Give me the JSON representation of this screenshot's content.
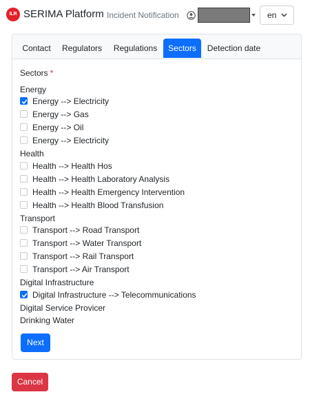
{
  "header": {
    "logo_text": "ILR",
    "brand": "SERIMA Platform",
    "nav_link": "Incident Notification",
    "language": "en"
  },
  "tabs": [
    {
      "label": "Contact"
    },
    {
      "label": "Regulators"
    },
    {
      "label": "Regulations"
    },
    {
      "label": "Sectors",
      "active": true
    },
    {
      "label": "Detection date"
    }
  ],
  "form": {
    "sectors_label": "Sectors",
    "required_marker": "*",
    "groups": [
      {
        "title": "Energy",
        "options": [
          {
            "label": "Energy --> Electricity",
            "checked": true
          },
          {
            "label": "Energy --> Gas",
            "checked": false
          },
          {
            "label": "Energy --> Oil",
            "checked": false
          },
          {
            "label": "Energy --> Electricity",
            "checked": false
          }
        ]
      },
      {
        "title": "Health",
        "options": [
          {
            "label": "Health --> Health Hos",
            "checked": false
          },
          {
            "label": "Health --> Health Laboratory Analysis",
            "checked": false
          },
          {
            "label": "Health --> Health Emergency Intervention",
            "checked": false
          },
          {
            "label": "Health --> Health Blood Transfusion",
            "checked": false
          }
        ]
      },
      {
        "title": "Transport",
        "options": [
          {
            "label": "Transport --> Road Transport",
            "checked": false
          },
          {
            "label": "Transport --> Water Transport",
            "checked": false
          },
          {
            "label": "Transport --> Rail Transport",
            "checked": false
          },
          {
            "label": "Transport --> Air Transport",
            "checked": false
          }
        ]
      },
      {
        "title": "Digital Infrastructure",
        "options": [
          {
            "label": "Digital Infrastructure --> Telecommunications",
            "checked": true
          }
        ]
      },
      {
        "title": "Digital Service Provicer",
        "options": []
      },
      {
        "title": "Drinking Water",
        "options": []
      }
    ],
    "next_label": "Next"
  },
  "cancel_label": "Cancel",
  "colors": {
    "primary": "#0d6efd",
    "danger": "#dc3545",
    "logo": "#e3202b"
  }
}
